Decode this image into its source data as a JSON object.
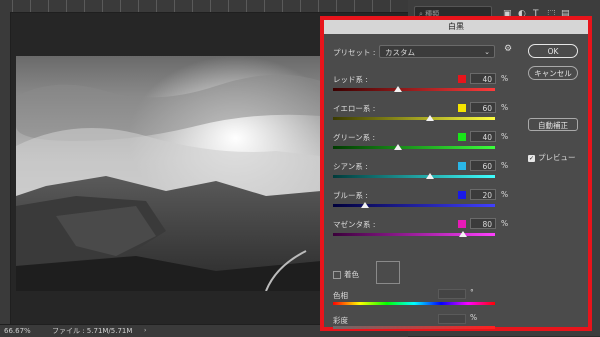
{
  "app": {
    "search_placeholder": "種類",
    "status_zoom": "66.67%",
    "status_file": "ファイル : 5.71M/5.71M"
  },
  "dialog": {
    "title": "白黒",
    "preset_label": "プリセット :",
    "preset_value": "カスタム",
    "percent_sign": "%",
    "degree_sign": "°",
    "sliders": [
      {
        "label": "レッド系 :",
        "value": "40",
        "swatch": "#e8141b",
        "gradient": [
          "#3a0000",
          "#ff3b3b"
        ],
        "level_percent": 40
      },
      {
        "label": "イエロー系 :",
        "value": "60",
        "swatch": "#f5e400",
        "gradient": [
          "#3a3a00",
          "#ffff40"
        ],
        "level_percent": 60
      },
      {
        "label": "グリーン系 :",
        "value": "40",
        "swatch": "#19e619",
        "gradient": [
          "#003a00",
          "#3bff3b"
        ],
        "level_percent": 40
      },
      {
        "label": "シアン系 :",
        "value": "60",
        "swatch": "#2ab7e8",
        "gradient": [
          "#003a3a",
          "#40ffff"
        ],
        "level_percent": 60
      },
      {
        "label": "ブルー系 :",
        "value": "20",
        "swatch": "#1a1ae8",
        "gradient": [
          "#00003a",
          "#4040ff"
        ],
        "level_percent": 20
      },
      {
        "label": "マゼンタ系 :",
        "value": "80",
        "swatch": "#e81ab7",
        "gradient": [
          "#3a003a",
          "#ff40ff"
        ],
        "level_percent": 80
      }
    ],
    "buttons": {
      "ok": "OK",
      "cancel": "キャンセル",
      "auto": "自動補正"
    },
    "preview_label": "プレビュー",
    "tint_label": "着色",
    "hue_label": "色相",
    "saturation_label": "彩度"
  },
  "colors": {
    "highlight": "#e8141b"
  },
  "icons": {
    "gear": "gear-icon",
    "chevron": "chevron-down-icon"
  }
}
